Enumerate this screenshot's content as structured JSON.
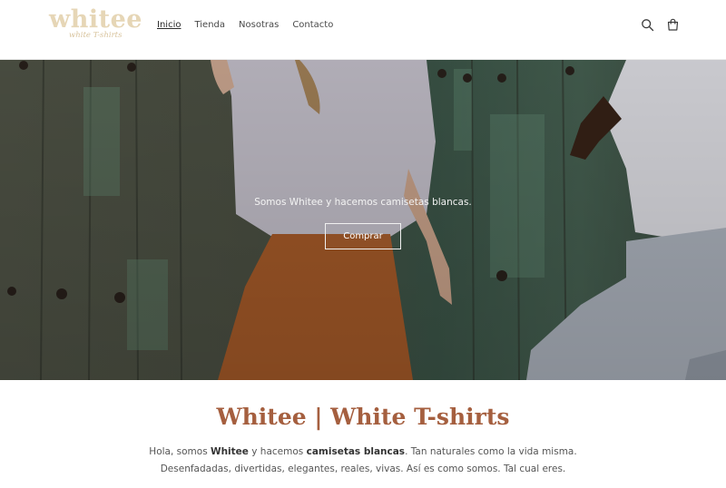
{
  "brand": {
    "logo_main": "whitee",
    "logo_sub": "white T-shirts"
  },
  "nav": {
    "items": [
      {
        "label": "Inicio",
        "active": true
      },
      {
        "label": "Tienda",
        "active": false
      },
      {
        "label": "Nosotras",
        "active": false
      },
      {
        "label": "Contacto",
        "active": false
      }
    ]
  },
  "header_icons": [
    "search-icon",
    "cart-icon"
  ],
  "hero": {
    "text": "Somos Whitee y hacemos camisetas blancas.",
    "button_label": "Comprar"
  },
  "intro": {
    "title": "Whitee | White T-shirts",
    "p1": "Hola, somos ",
    "b1": "Whitee",
    "p2": " y hacemos ",
    "b2": "camisetas blancas",
    "p3": ". Tan naturales como la vida misma. Desenfadadas, divertidas, elegantes, reales, vivas. Así es como somos. Tal cual eres."
  },
  "colors": {
    "accent": "#a55f3f",
    "logo": "#e6d6b6"
  }
}
